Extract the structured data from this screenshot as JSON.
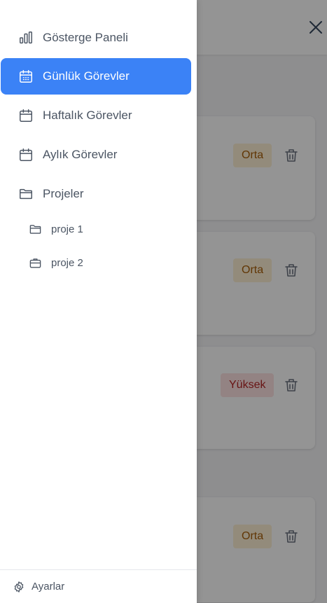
{
  "sidebar": {
    "items": [
      {
        "label": "Gösterge Paneli",
        "icon": "bar-chart-icon",
        "active": false
      },
      {
        "label": "Günlük Görevler",
        "icon": "calendar-icon",
        "active": true
      },
      {
        "label": "Haftalık Görevler",
        "icon": "calendar-icon",
        "active": false
      },
      {
        "label": "Aylık Görevler",
        "icon": "calendar-icon",
        "active": false
      },
      {
        "label": "Projeler",
        "icon": "folder-icon",
        "active": false
      }
    ],
    "projects": [
      {
        "label": "proje 1",
        "icon": "folder-icon"
      },
      {
        "label": "proje 2",
        "icon": "briefcase-icon"
      }
    ],
    "footer": {
      "settings_label": "Ayarlar",
      "icon": "gear-icon"
    }
  },
  "background": {
    "tasks": [
      {
        "priority": "Orta",
        "priority_color": "#a85d08"
      },
      {
        "priority": "Orta",
        "priority_color": "#a85d08"
      },
      {
        "priority": "Yüksek",
        "priority_color": "#b42323"
      },
      {
        "priority": "Orta",
        "priority_color": "#a85d08"
      }
    ]
  },
  "colors": {
    "accent": "#3b82f6",
    "overlay": "#000000"
  }
}
